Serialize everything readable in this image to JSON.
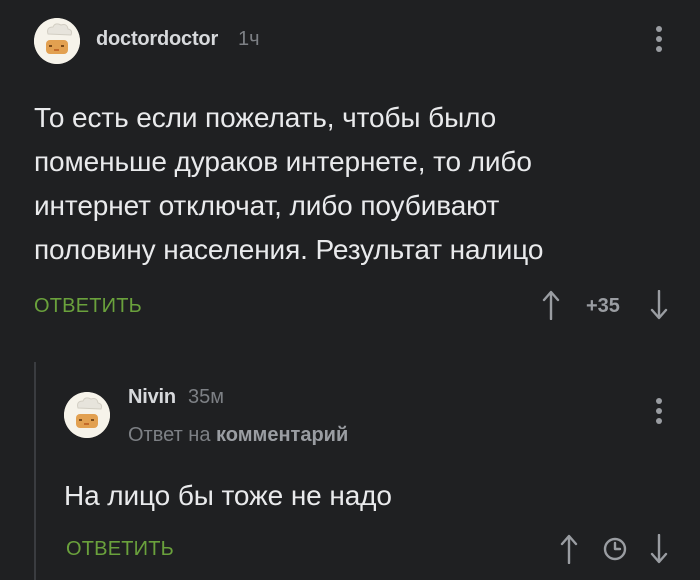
{
  "comment": {
    "author": "doctordoctor",
    "time": "1ч",
    "text_lines": [
      "То есть если пожелать, чтобы было",
      "поменьше дураков интернете, то либо",
      "интернет отключат, либо поубивают",
      "половину населения. Результат налицо"
    ],
    "reply_label": "ОТВЕТИТЬ",
    "rating": "+35",
    "icons": {
      "upvote": "arrow-up-icon",
      "downvote": "arrow-down-icon",
      "more": "kebab-menu-icon"
    }
  },
  "reply": {
    "author": "Nivin",
    "time": "35м",
    "reply_to_prefix": "Ответ на",
    "reply_to_target": "комментарий",
    "text": "На лицо бы тоже не надо",
    "reply_label": "ОТВЕТИТЬ",
    "icons": {
      "upvote": "arrow-up-icon",
      "timer": "clock-icon",
      "downvote": "arrow-down-icon",
      "more": "kebab-menu-icon"
    }
  },
  "colors": {
    "background": "#1f2022",
    "text": "#e9eaec",
    "accent_green": "#6aa13c",
    "muted": "#7d8085"
  }
}
